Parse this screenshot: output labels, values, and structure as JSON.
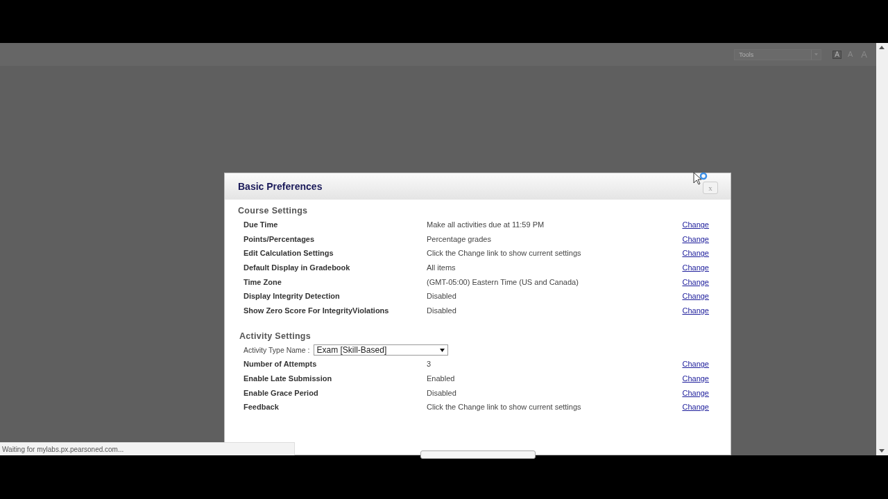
{
  "toolbar": {
    "tools_select": "Tools",
    "font_size_buttons": [
      {
        "label": "A",
        "selected": true
      },
      {
        "label": "A",
        "selected": false
      },
      {
        "label": "A",
        "selected": false
      }
    ]
  },
  "dialog": {
    "title": "Basic Preferences",
    "close": "x",
    "sections": [
      {
        "heading": "Course Settings",
        "rows": [
          {
            "name": "Due Time",
            "value": "Make all activities due at 11:59 PM",
            "action": "Change"
          },
          {
            "name": "Points/Percentages",
            "value": "Percentage grades",
            "action": "Change"
          },
          {
            "name": "Edit Calculation Settings",
            "value": "Click the Change link to show current settings",
            "action": "Change"
          },
          {
            "name": "Default Display in Gradebook",
            "value": "All items",
            "action": "Change"
          },
          {
            "name": "Time Zone",
            "value": "(GMT-05:00) Eastern Time (US and Canada)",
            "action": "Change"
          },
          {
            "name": "Display Integrity Detection",
            "value": "Disabled",
            "action": "Change"
          },
          {
            "name": "Show Zero Score For IntegrityViolations",
            "value": "Disabled",
            "action": "Change"
          }
        ]
      },
      {
        "heading": "Activity Settings",
        "activity_type": {
          "label": "Activity Type Name :",
          "value": "Exam [Skill-Based]"
        },
        "rows": [
          {
            "name": "Number of Attempts",
            "value": "3",
            "action": "Change"
          },
          {
            "name": "Enable Late Submission",
            "value": "Enabled",
            "action": "Change"
          },
          {
            "name": "Enable Grace Period",
            "value": "Disabled",
            "action": "Change"
          },
          {
            "name": "Feedback",
            "value": "Click the Change link to show current settings",
            "action": "Change"
          }
        ]
      }
    ]
  },
  "status_bar": "Waiting for mylabs.px.pearsoned.com..."
}
